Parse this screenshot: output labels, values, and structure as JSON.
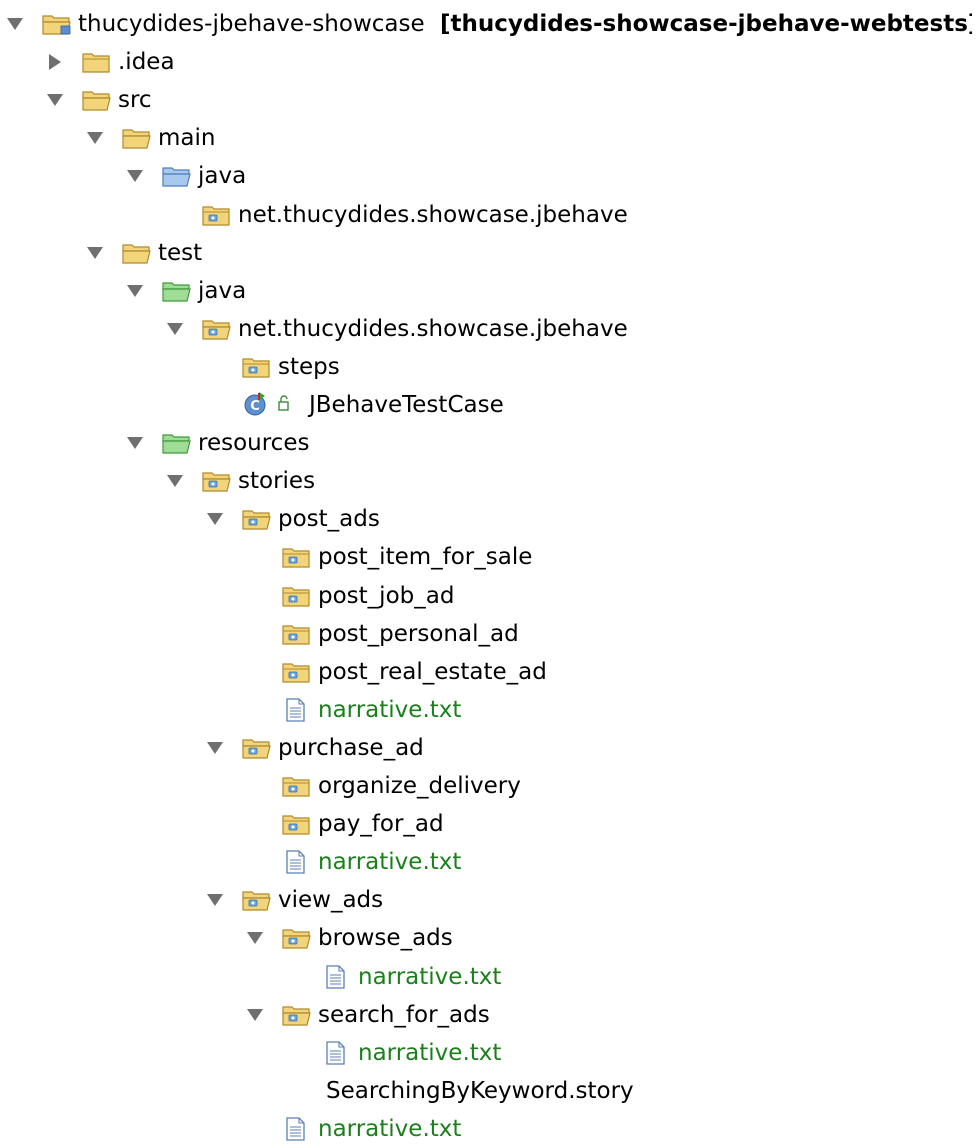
{
  "tree": {
    "root": {
      "name": "thucydides-jbehave-showcase",
      "working_set": "[thucydides-showcase-jbehave-webtests]"
    },
    "nodes": [
      {
        "label": "thucydides-jbehave-showcase",
        "depth": 0,
        "twisty": "expanded",
        "icon": "project-folder-icon"
      },
      {
        "label": ".idea",
        "depth": 1,
        "twisty": "collapsed",
        "icon": "folder-icon"
      },
      {
        "label": "src",
        "depth": 1,
        "twisty": "expanded",
        "icon": "folder-open-icon"
      },
      {
        "label": "main",
        "depth": 2,
        "twisty": "expanded",
        "icon": "folder-open-icon"
      },
      {
        "label": "java",
        "depth": 3,
        "twisty": "expanded",
        "icon": "source-folder-blue-icon"
      },
      {
        "label": "net.thucydides.showcase.jbehave",
        "depth": 4,
        "twisty": "none",
        "icon": "package-icon"
      },
      {
        "label": "test",
        "depth": 2,
        "twisty": "expanded",
        "icon": "folder-open-icon"
      },
      {
        "label": "java",
        "depth": 3,
        "twisty": "expanded",
        "icon": "source-folder-green-icon"
      },
      {
        "label": "net.thucydides.showcase.jbehave",
        "depth": 4,
        "twisty": "expanded",
        "icon": "package-open-icon"
      },
      {
        "label": "steps",
        "depth": 5,
        "twisty": "none",
        "icon": "package-icon"
      },
      {
        "label": "JBehaveTestCase",
        "depth": 5,
        "twisty": "none",
        "icon": "class-icon"
      },
      {
        "label": "resources",
        "depth": 3,
        "twisty": "expanded",
        "icon": "resource-folder-green-icon"
      },
      {
        "label": "stories",
        "depth": 4,
        "twisty": "expanded",
        "icon": "package-open-icon"
      },
      {
        "label": "post_ads",
        "depth": 5,
        "twisty": "expanded",
        "icon": "package-open-icon"
      },
      {
        "label": "post_item_for_sale",
        "depth": 6,
        "twisty": "none",
        "icon": "package-icon"
      },
      {
        "label": "post_job_ad",
        "depth": 6,
        "twisty": "none",
        "icon": "package-icon"
      },
      {
        "label": "post_personal_ad",
        "depth": 6,
        "twisty": "none",
        "icon": "package-icon"
      },
      {
        "label": "post_real_estate_ad",
        "depth": 6,
        "twisty": "none",
        "icon": "package-icon"
      },
      {
        "label": "narrative.txt",
        "depth": 6,
        "twisty": "none",
        "icon": "text-file-icon",
        "color": "#1b7f1b"
      },
      {
        "label": "purchase_ad",
        "depth": 5,
        "twisty": "expanded",
        "icon": "package-open-icon"
      },
      {
        "label": "organize_delivery",
        "depth": 6,
        "twisty": "none",
        "icon": "package-icon"
      },
      {
        "label": "pay_for_ad",
        "depth": 6,
        "twisty": "none",
        "icon": "package-icon"
      },
      {
        "label": "narrative.txt",
        "depth": 6,
        "twisty": "none",
        "icon": "text-file-icon",
        "color": "#1b7f1b"
      },
      {
        "label": "view_ads",
        "depth": 5,
        "twisty": "expanded",
        "icon": "package-open-icon"
      },
      {
        "label": "browse_ads",
        "depth": 6,
        "twisty": "expanded",
        "icon": "package-open-icon"
      },
      {
        "label": "narrative.txt",
        "depth": 7,
        "twisty": "none",
        "icon": "text-file-icon",
        "color": "#1b7f1b"
      },
      {
        "label": "search_for_ads",
        "depth": 6,
        "twisty": "expanded",
        "icon": "package-open-icon"
      },
      {
        "label": "narrative.txt",
        "depth": 7,
        "twisty": "none",
        "icon": "text-file-icon",
        "color": "#1b7f1b"
      },
      {
        "label": "SearchingByKeyword.story",
        "depth": 7,
        "twisty": "none",
        "icon": "none"
      },
      {
        "label": "narrative.txt",
        "depth": 6,
        "twisty": "none",
        "icon": "text-file-icon",
        "color": "#1b7f1b"
      }
    ]
  },
  "colors": {
    "text_green": "#1b7f1b",
    "twisty": "#6f6f6f",
    "folder_yellow": "#f2d57a",
    "folder_blue": "#8fb6e6",
    "folder_green": "#8fd68a"
  }
}
